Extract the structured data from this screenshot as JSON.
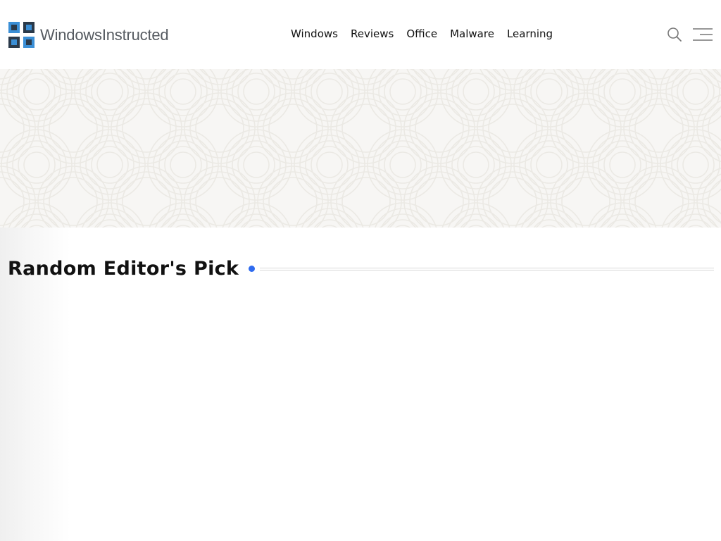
{
  "header": {
    "logo_text": "WindowsInstructed",
    "nav": [
      {
        "label": "Windows"
      },
      {
        "label": "Reviews"
      },
      {
        "label": "Office"
      },
      {
        "label": "Malware"
      },
      {
        "label": "Learning"
      }
    ],
    "icons": {
      "logo": "windows-squares-logo-icon",
      "search": "search-icon",
      "menu": "hamburger-menu-icon"
    }
  },
  "section": {
    "title": "Random Editor's Pick"
  },
  "colors": {
    "accent": "#2f6bef",
    "logo_blue": "#3b8fd6",
    "logo_dark": "#2b3a4a",
    "banner_bg": "#f7f6f4",
    "text": "#111111"
  }
}
